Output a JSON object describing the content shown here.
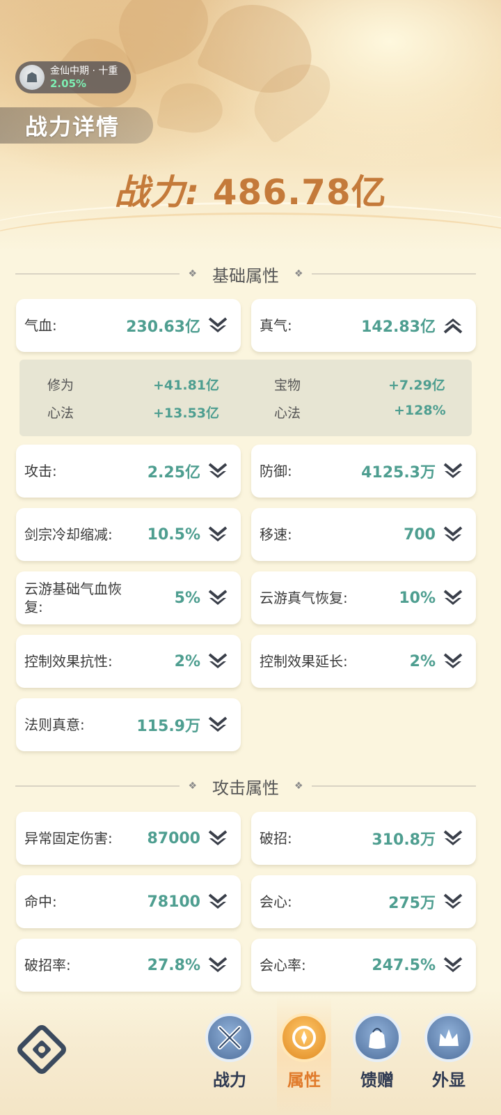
{
  "header": {
    "realm_name": "金仙中期 · 十重",
    "realm_progress": "2.05%",
    "title": "战力详情",
    "power_label": "战力:",
    "power_value": "486.78亿"
  },
  "sections": {
    "basic": "基础属性",
    "attack": "攻击属性"
  },
  "basic_stats": [
    {
      "label": "气血:",
      "value": "230.63亿",
      "expanded": false
    },
    {
      "label": "真气:",
      "value": "142.83亿",
      "expanded": true
    },
    {
      "label": "攻击:",
      "value": "2.25亿",
      "expanded": false
    },
    {
      "label": "防御:",
      "value": "4125.3万",
      "expanded": false
    },
    {
      "label": "剑宗冷却缩减:",
      "value": "10.5%",
      "expanded": false
    },
    {
      "label": "移速:",
      "value": "700",
      "expanded": false
    },
    {
      "label": "云游基础气血恢复:",
      "value": "5%",
      "expanded": false
    },
    {
      "label": "云游真气恢复:",
      "value": "10%",
      "expanded": false
    },
    {
      "label": "控制效果抗性:",
      "value": "2%",
      "expanded": false
    },
    {
      "label": "控制效果延长:",
      "value": "2%",
      "expanded": false
    },
    {
      "label": "法则真意:",
      "value": "115.9万",
      "expanded": false
    }
  ],
  "zhenqi_detail": [
    {
      "label": "修为",
      "value": "+41.81亿"
    },
    {
      "label": "宝物",
      "value": "+7.29亿"
    },
    {
      "label": "心法",
      "value": "+13.53亿"
    },
    {
      "label": "心法",
      "value": "+128%"
    }
  ],
  "attack_stats": [
    {
      "label": "异常固定伤害:",
      "value": "87000"
    },
    {
      "label": "破招:",
      "value": "310.8万"
    },
    {
      "label": "命中:",
      "value": "78100"
    },
    {
      "label": "会心:",
      "value": "275万"
    },
    {
      "label": "破招率:",
      "value": "27.8%"
    },
    {
      "label": "会心率:",
      "value": "247.5%"
    }
  ],
  "nav": [
    {
      "label": "战力",
      "icon": "crossed-swords-icon",
      "active": false
    },
    {
      "label": "属性",
      "icon": "attribute-shield-icon",
      "active": true
    },
    {
      "label": "馈赠",
      "icon": "gift-bag-icon",
      "active": false
    },
    {
      "label": "外显",
      "icon": "crown-appearance-icon",
      "active": false
    }
  ],
  "colors": {
    "accent_value": "#4e9e90",
    "power": "#c47a3a",
    "active_tab": "#e07a2a"
  }
}
